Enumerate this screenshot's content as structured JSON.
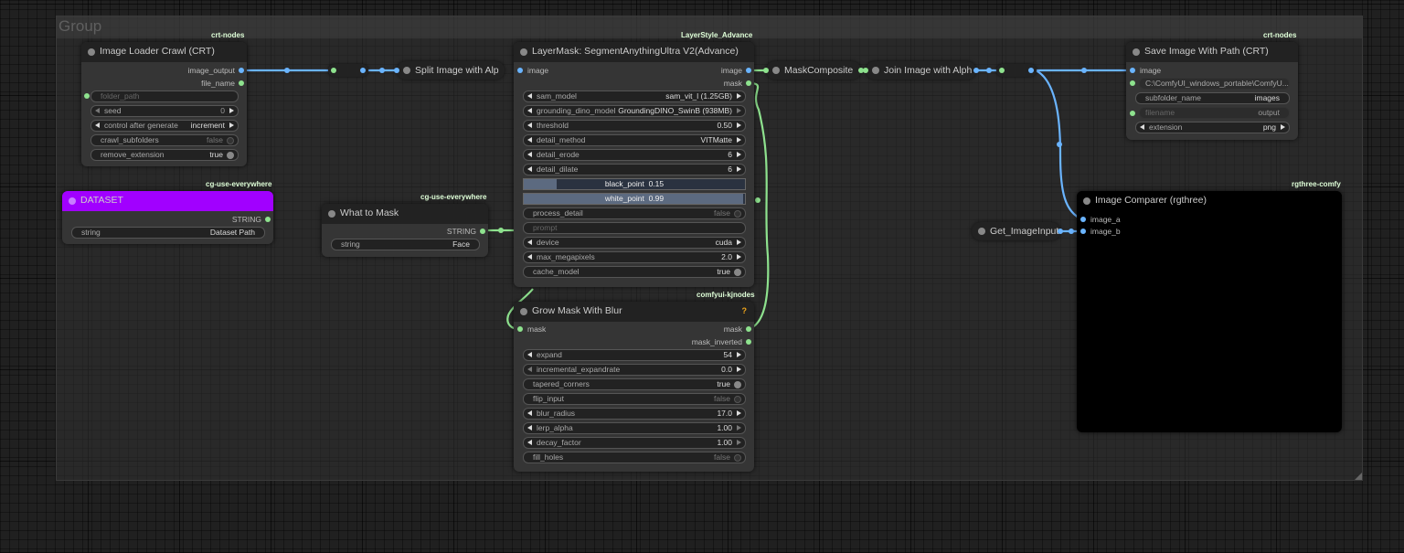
{
  "group": {
    "title": "Group"
  },
  "colors": {
    "int_wire": "#6ab4ff",
    "mask_wire": "#8ee28e",
    "dataset_title": "#a100ff"
  },
  "nodes": {
    "image_loader": {
      "badge": "crt-nodes",
      "title": "Image Loader Crawl (CRT)",
      "outputs": [
        "image_output",
        "file_name"
      ],
      "folder_path": "folder_path",
      "seed": {
        "label": "seed",
        "value": "0"
      },
      "control": {
        "label": "control after generate",
        "value": "increment"
      },
      "crawl_subfolders": {
        "label": "crawl_subfolders",
        "value": "false"
      },
      "remove_extension": {
        "label": "remove_extension",
        "value": "true"
      }
    },
    "dataset": {
      "badge": "cg-use-everywhere",
      "title": "DATASET",
      "output": "STRING",
      "widget": {
        "label": "string",
        "value": "Dataset Path"
      }
    },
    "what_to_mask": {
      "badge": "cg-use-everywhere",
      "title": "What to Mask",
      "output": "STRING",
      "widget": {
        "label": "string",
        "value": "Face"
      }
    },
    "split": {
      "title": "Split Image with Alp"
    },
    "segment": {
      "badge": "LayerStyle_Advance",
      "title": "LayerMask: SegmentAnythingUltra V2(Advance)",
      "input": "image",
      "outputs": [
        "image",
        "mask"
      ],
      "sam_model": {
        "label": "sam_model",
        "value": "sam_vit_l (1.25GB)"
      },
      "grounding": {
        "label": "grounding_dino_model",
        "value": "GroundingDINO_SwinB (938MB)"
      },
      "threshold": {
        "label": "threshold",
        "value": "0.50"
      },
      "detail_method": {
        "label": "detail_method",
        "value": "VITMatte"
      },
      "detail_erode": {
        "label": "detail_erode",
        "value": "6"
      },
      "detail_dilate": {
        "label": "detail_dilate",
        "value": "6"
      },
      "black_point": {
        "label": "black_point",
        "value": "0.15"
      },
      "white_point": {
        "label": "white_point",
        "value": "0.99"
      },
      "process_detail": {
        "label": "process_detail",
        "value": "false"
      },
      "prompt": "prompt",
      "device": {
        "label": "device",
        "value": "cuda"
      },
      "max_megapixels": {
        "label": "max_megapixels",
        "value": "2.0"
      },
      "cache_model": {
        "label": "cache_model",
        "value": "true"
      }
    },
    "grow_mask": {
      "badge": "comfyui-kjnodes",
      "title": "Grow Mask With Blur",
      "help": "?",
      "input": "mask",
      "outputs": [
        "mask",
        "mask_inverted"
      ],
      "expand": {
        "label": "expand",
        "value": "54"
      },
      "incremental_expandrate": {
        "label": "incremental_expandrate",
        "value": "0.0"
      },
      "tapered_corners": {
        "label": "tapered_corners",
        "value": "true"
      },
      "flip_input": {
        "label": "flip_input",
        "value": "false"
      },
      "blur_radius": {
        "label": "blur_radius",
        "value": "17.0"
      },
      "lerp_alpha": {
        "label": "lerp_alpha",
        "value": "1.00"
      },
      "decay_factor": {
        "label": "decay_factor",
        "value": "1.00"
      },
      "fill_holes": {
        "label": "fill_holes",
        "value": "false"
      }
    },
    "mask_composite": {
      "title": "MaskComposite"
    },
    "join": {
      "title": "Join Image with Alph"
    },
    "save": {
      "badge": "crt-nodes",
      "title": "Save Image With Path (CRT)",
      "input": "image",
      "path": "C:\\ComfyUI_windows_portable\\ComfyU...",
      "subfolder_name": {
        "label": "subfolder_name",
        "value": "images"
      },
      "filename": {
        "label": "filename",
        "value": "output"
      },
      "extension": {
        "label": "extension",
        "value": "png"
      }
    },
    "comparer": {
      "badge": "rgthree-comfy",
      "title": "Image Comparer (rgthree)",
      "inputs": [
        "image_a",
        "image_b"
      ]
    },
    "get_image": {
      "title": "Get_ImageInput"
    }
  }
}
